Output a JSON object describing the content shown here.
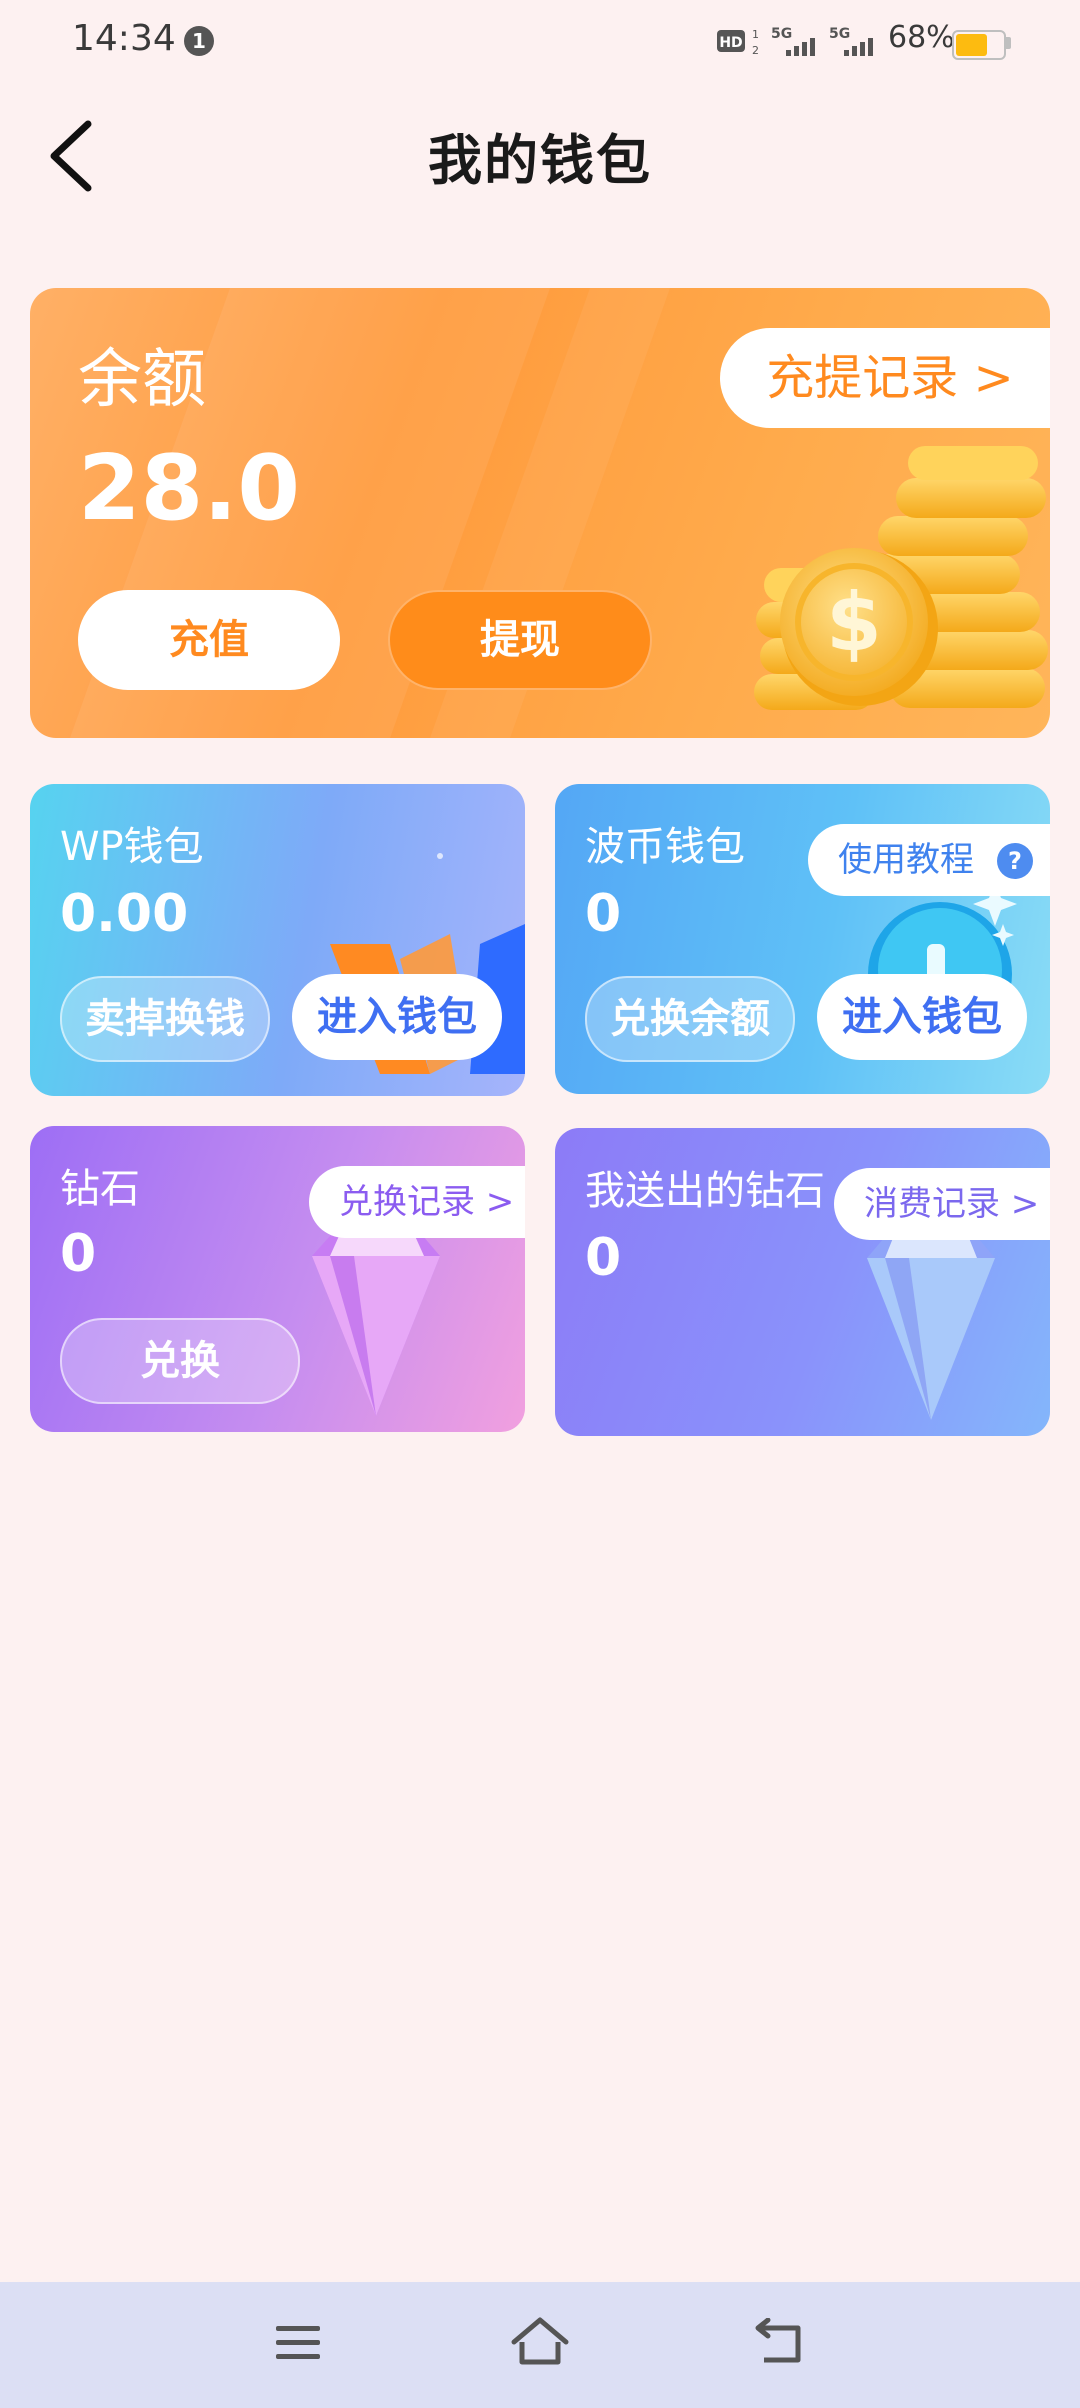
{
  "status_bar": {
    "time": "14:34",
    "notification_count": "1",
    "battery_percent": "68%",
    "battery_level": 0.68,
    "network_labels": [
      "HD",
      "5G",
      "5G"
    ]
  },
  "header": {
    "title": "我的钱包",
    "back_icon": "chevron-left-icon"
  },
  "balance": {
    "label": "余额",
    "value": "28.0",
    "records_label": "充提记录 >",
    "recharge_label": "充值",
    "withdraw_label": "提现",
    "accent": "#ff8a1f"
  },
  "wp_wallet": {
    "label": "WP钱包",
    "value": "0.00",
    "sell_label": "卖掉换钱",
    "enter_label": "进入钱包"
  },
  "bobi_wallet": {
    "label": "波币钱包",
    "value": "0",
    "tutorial_label": "使用教程",
    "exchange_label": "兑换余额",
    "enter_label": "进入钱包"
  },
  "diamonds": {
    "label": "钻石",
    "value": "0",
    "records_label": "兑换记录 >",
    "exchange_label": "兑换"
  },
  "sent_diamonds": {
    "label": "我送出的钻石",
    "value": "0",
    "records_label": "消费记录 >"
  },
  "nav_bar": {
    "icons": [
      "menu-icon",
      "home-icon",
      "back-icon"
    ]
  }
}
